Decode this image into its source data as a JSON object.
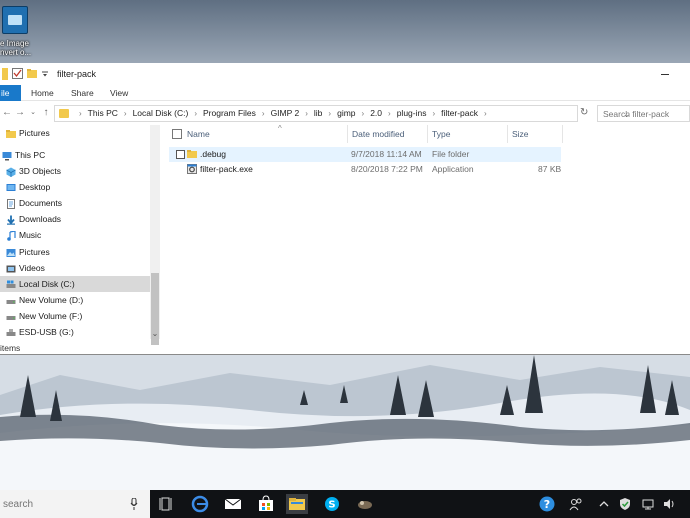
{
  "desktop": {
    "icon_label_line1": "e Image",
    "icon_label_line2": "nvert o..."
  },
  "window": {
    "title": "filter-pack",
    "ribbon_tabs": {
      "file": "ile",
      "home": "Home",
      "share": "Share",
      "view": "View"
    },
    "address": {
      "crumbs": [
        "This PC",
        "Local Disk (C:)",
        "Program Files",
        "GIMP 2",
        "lib",
        "gimp",
        "2.0",
        "plug-ins",
        "filter-pack"
      ]
    },
    "search_placeholder": "Search filter-pack",
    "nav_pane": [
      {
        "label": "Pictures",
        "icon": "folder-icon",
        "selected": false
      },
      {
        "label": "This PC",
        "icon": "computer-icon",
        "selected": false
      },
      {
        "label": "3D Objects",
        "icon": "cube-icon",
        "selected": false
      },
      {
        "label": "Desktop",
        "icon": "desktop-icon",
        "selected": false
      },
      {
        "label": "Documents",
        "icon": "documents-icon",
        "selected": false
      },
      {
        "label": "Downloads",
        "icon": "download-arrow-icon",
        "selected": false
      },
      {
        "label": "Music",
        "icon": "music-note-icon",
        "selected": false
      },
      {
        "label": "Pictures",
        "icon": "pictures-icon",
        "selected": false
      },
      {
        "label": "Videos",
        "icon": "film-icon",
        "selected": false
      },
      {
        "label": "Local Disk (C:)",
        "icon": "drive-windows-icon",
        "selected": true
      },
      {
        "label": "New Volume (D:)",
        "icon": "drive-icon",
        "selected": false
      },
      {
        "label": "New Volume (F:)",
        "icon": "drive-icon",
        "selected": false
      },
      {
        "label": "ESD-USB (G:)",
        "icon": "usb-drive-icon",
        "selected": false
      }
    ],
    "columns": {
      "name": "Name",
      "date": "Date modified",
      "type": "Type",
      "size": "Size"
    },
    "files": [
      {
        "name": ".debug",
        "date": "9/7/2018 11:14 AM",
        "type": "File folder",
        "size": "",
        "icon": "folder-icon"
      },
      {
        "name": "filter-pack.exe",
        "date": "8/20/2018 7:22 PM",
        "type": "Application",
        "size": "87 KB",
        "icon": "exe-gear-icon"
      }
    ],
    "status_text": "items"
  },
  "taskbar": {
    "search_placeholder": "search",
    "apps": [
      "task-view-icon",
      "edge-icon",
      "mail-icon",
      "store-icon",
      "file-explorer-icon",
      "skype-icon",
      "gimp-icon"
    ],
    "active_app": "file-explorer-icon",
    "tray": [
      "help-icon",
      "people-icon",
      "chevron-up-icon",
      "security-shield-icon",
      "network-icon",
      "volume-icon"
    ]
  },
  "colors": {
    "accent": "#1979ca",
    "selection": "#e5f3ff",
    "nav_selected": "#d9d9d9",
    "taskbar": "#101215",
    "folder": "#f2c94c"
  }
}
